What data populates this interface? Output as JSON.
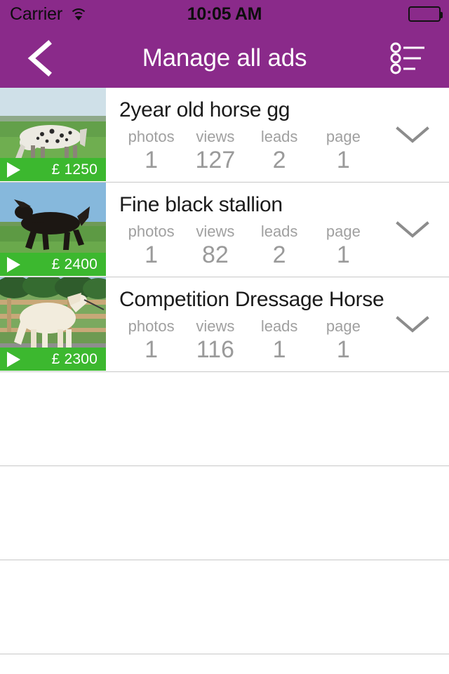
{
  "status_bar": {
    "carrier": "Carrier",
    "wifi_icon": "wifi-icon",
    "time": "10:05 AM",
    "battery_icon": "battery-full-icon"
  },
  "nav_bar": {
    "back_icon": "chevron-left-icon",
    "title": "Manage all ads",
    "menu_icon": "list-options-icon"
  },
  "theme": {
    "header_purple": "#8A2A8A",
    "price_green": "#3CB82F",
    "separator_gray": "#C8C8C8",
    "stat_label_gray": "#A0A0A0",
    "stat_value_gray": "#9A9A9A",
    "title_dark": "#1B1B1B"
  },
  "stat_labels": {
    "photos": "photos",
    "views": "views",
    "leads": "leads",
    "page": "page"
  },
  "ads": [
    {
      "title": "2year old horse gg",
      "price": "£ 1250",
      "photos": "1",
      "views": "127",
      "leads": "2",
      "page": "1",
      "expand_icon": "chevron-down-icon",
      "play_icon": "play-triangle-icon",
      "thumbnail": "appaloosa-horse-grazing-photo"
    },
    {
      "title": "Fine black stallion",
      "price": "£ 2400",
      "photos": "1",
      "views": "82",
      "leads": "2",
      "page": "1",
      "expand_icon": "chevron-down-icon",
      "play_icon": "play-triangle-icon",
      "thumbnail": "black-stallion-trotting-photo"
    },
    {
      "title": "Competition Dressage Horse",
      "price": "£ 2300",
      "photos": "1",
      "views": "116",
      "leads": "1",
      "page": "1",
      "expand_icon": "chevron-down-icon",
      "play_icon": "play-triangle-icon",
      "thumbnail": "cremello-dressage-horse-photo"
    }
  ],
  "empty_rows": 3
}
